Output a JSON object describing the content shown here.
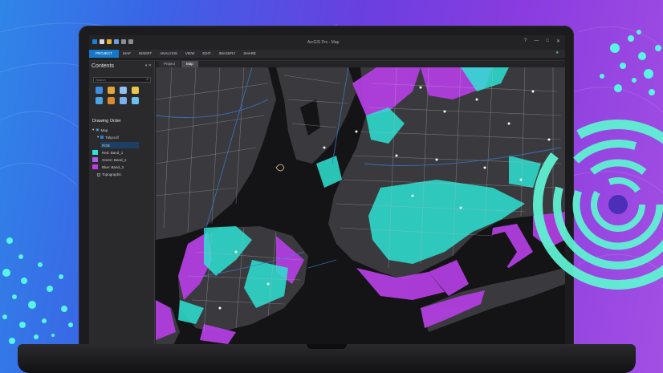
{
  "titlebar": {
    "app_title": "ArcGIS Pro - Map",
    "help": "?",
    "minimize": "—",
    "maximize": "□",
    "close": "✕"
  },
  "ribbon": {
    "tabs": [
      "PROJECT",
      "MAP",
      "INSERT",
      "ANALYSIS",
      "VIEW",
      "EDIT",
      "IMAGERY",
      "SHARE"
    ],
    "active_tab": "PROJECT"
  },
  "contents": {
    "title": "Contents",
    "pane_controls": "▾ ✕",
    "search_placeholder": "Search",
    "drawing_order_label": "Drawing Order",
    "layers": [
      {
        "label": "Map",
        "indent": 0,
        "checked": true
      },
      {
        "label": "Tokyo.tif",
        "indent": 1,
        "checked": true
      },
      {
        "label": "RGB",
        "indent": 2,
        "checked": false,
        "selected": true
      },
      {
        "label": "Red:  Band_1",
        "indent": 3,
        "swatch": "#2de3d2"
      },
      {
        "label": "Green: Band_2",
        "indent": 3,
        "swatch": "#a660ea"
      },
      {
        "label": "Blue:  Band_3",
        "indent": 3,
        "swatch": "#c43be0"
      },
      {
        "label": "Topographic",
        "indent": 1,
        "checked": false
      }
    ]
  },
  "map_tabs": [
    {
      "label": "Project",
      "active": false
    },
    {
      "label": "Map",
      "active": true
    }
  ],
  "colors": {
    "accent": "#1677c9",
    "flood_cyan": "#2de3d2",
    "flood_purple": "#b23ee0",
    "land": "#3a3a3e",
    "water": "#141416"
  }
}
